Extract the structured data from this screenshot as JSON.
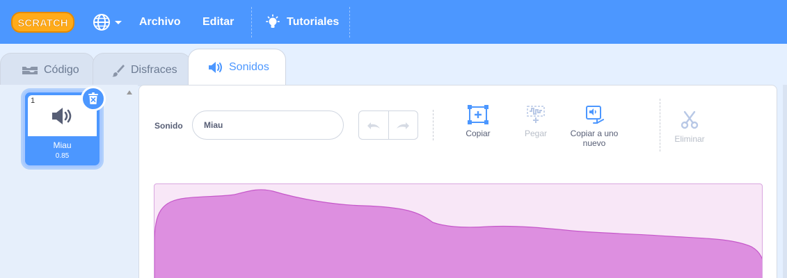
{
  "menubar": {
    "logo_text": "SCRATCH",
    "language_icon": "globe-icon",
    "items": [
      "Archivo",
      "Editar"
    ],
    "tutorials_label": "Tutoriales",
    "colors": {
      "bar": "#4c97ff",
      "logo_fill": "#ffab19",
      "logo_outline": "#e58a00"
    }
  },
  "tabs": [
    {
      "label": "Código",
      "icon": "code-blocks-icon"
    },
    {
      "label": "Disfraces",
      "icon": "brush-icon"
    },
    {
      "label": "Sonidos",
      "icon": "speaker-icon",
      "active": true
    }
  ],
  "sound_list": {
    "items": [
      {
        "index": "1",
        "name": "Miau",
        "duration": "0.85",
        "selected": true
      }
    ]
  },
  "editor": {
    "sound_label": "Sonido",
    "sound_name": "Miau",
    "tools": [
      {
        "label": "Copiar",
        "icon": "copy-selection-icon",
        "enabled": true
      },
      {
        "label": "Pegar",
        "icon": "paste-icon",
        "enabled": false
      },
      {
        "label": "Copiar a uno nuevo",
        "icon": "copy-to-new-icon",
        "enabled": true
      },
      {
        "label": "Eliminar",
        "icon": "scissors-icon",
        "enabled": false
      }
    ],
    "undo_icon": "undo-icon",
    "redo_icon": "redo-icon",
    "colors": {
      "wave_fill": "#dd8fe0",
      "wave_stroke": "#c558c9",
      "wave_bg": "#f8e7f7",
      "accent": "#4c97ff"
    }
  }
}
